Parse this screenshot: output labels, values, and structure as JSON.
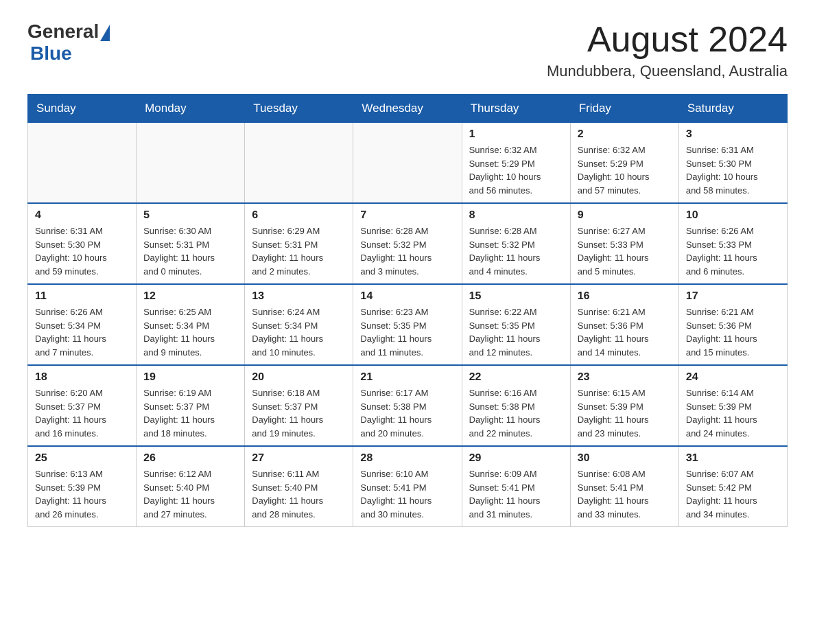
{
  "header": {
    "month_title": "August 2024",
    "location": "Mundubbera, Queensland, Australia",
    "logo_general": "General",
    "logo_blue": "Blue"
  },
  "weekdays": [
    "Sunday",
    "Monday",
    "Tuesday",
    "Wednesday",
    "Thursday",
    "Friday",
    "Saturday"
  ],
  "weeks": [
    [
      {
        "day": "",
        "info": ""
      },
      {
        "day": "",
        "info": ""
      },
      {
        "day": "",
        "info": ""
      },
      {
        "day": "",
        "info": ""
      },
      {
        "day": "1",
        "info": "Sunrise: 6:32 AM\nSunset: 5:29 PM\nDaylight: 10 hours\nand 56 minutes."
      },
      {
        "day": "2",
        "info": "Sunrise: 6:32 AM\nSunset: 5:29 PM\nDaylight: 10 hours\nand 57 minutes."
      },
      {
        "day": "3",
        "info": "Sunrise: 6:31 AM\nSunset: 5:30 PM\nDaylight: 10 hours\nand 58 minutes."
      }
    ],
    [
      {
        "day": "4",
        "info": "Sunrise: 6:31 AM\nSunset: 5:30 PM\nDaylight: 10 hours\nand 59 minutes."
      },
      {
        "day": "5",
        "info": "Sunrise: 6:30 AM\nSunset: 5:31 PM\nDaylight: 11 hours\nand 0 minutes."
      },
      {
        "day": "6",
        "info": "Sunrise: 6:29 AM\nSunset: 5:31 PM\nDaylight: 11 hours\nand 2 minutes."
      },
      {
        "day": "7",
        "info": "Sunrise: 6:28 AM\nSunset: 5:32 PM\nDaylight: 11 hours\nand 3 minutes."
      },
      {
        "day": "8",
        "info": "Sunrise: 6:28 AM\nSunset: 5:32 PM\nDaylight: 11 hours\nand 4 minutes."
      },
      {
        "day": "9",
        "info": "Sunrise: 6:27 AM\nSunset: 5:33 PM\nDaylight: 11 hours\nand 5 minutes."
      },
      {
        "day": "10",
        "info": "Sunrise: 6:26 AM\nSunset: 5:33 PM\nDaylight: 11 hours\nand 6 minutes."
      }
    ],
    [
      {
        "day": "11",
        "info": "Sunrise: 6:26 AM\nSunset: 5:34 PM\nDaylight: 11 hours\nand 7 minutes."
      },
      {
        "day": "12",
        "info": "Sunrise: 6:25 AM\nSunset: 5:34 PM\nDaylight: 11 hours\nand 9 minutes."
      },
      {
        "day": "13",
        "info": "Sunrise: 6:24 AM\nSunset: 5:34 PM\nDaylight: 11 hours\nand 10 minutes."
      },
      {
        "day": "14",
        "info": "Sunrise: 6:23 AM\nSunset: 5:35 PM\nDaylight: 11 hours\nand 11 minutes."
      },
      {
        "day": "15",
        "info": "Sunrise: 6:22 AM\nSunset: 5:35 PM\nDaylight: 11 hours\nand 12 minutes."
      },
      {
        "day": "16",
        "info": "Sunrise: 6:21 AM\nSunset: 5:36 PM\nDaylight: 11 hours\nand 14 minutes."
      },
      {
        "day": "17",
        "info": "Sunrise: 6:21 AM\nSunset: 5:36 PM\nDaylight: 11 hours\nand 15 minutes."
      }
    ],
    [
      {
        "day": "18",
        "info": "Sunrise: 6:20 AM\nSunset: 5:37 PM\nDaylight: 11 hours\nand 16 minutes."
      },
      {
        "day": "19",
        "info": "Sunrise: 6:19 AM\nSunset: 5:37 PM\nDaylight: 11 hours\nand 18 minutes."
      },
      {
        "day": "20",
        "info": "Sunrise: 6:18 AM\nSunset: 5:37 PM\nDaylight: 11 hours\nand 19 minutes."
      },
      {
        "day": "21",
        "info": "Sunrise: 6:17 AM\nSunset: 5:38 PM\nDaylight: 11 hours\nand 20 minutes."
      },
      {
        "day": "22",
        "info": "Sunrise: 6:16 AM\nSunset: 5:38 PM\nDaylight: 11 hours\nand 22 minutes."
      },
      {
        "day": "23",
        "info": "Sunrise: 6:15 AM\nSunset: 5:39 PM\nDaylight: 11 hours\nand 23 minutes."
      },
      {
        "day": "24",
        "info": "Sunrise: 6:14 AM\nSunset: 5:39 PM\nDaylight: 11 hours\nand 24 minutes."
      }
    ],
    [
      {
        "day": "25",
        "info": "Sunrise: 6:13 AM\nSunset: 5:39 PM\nDaylight: 11 hours\nand 26 minutes."
      },
      {
        "day": "26",
        "info": "Sunrise: 6:12 AM\nSunset: 5:40 PM\nDaylight: 11 hours\nand 27 minutes."
      },
      {
        "day": "27",
        "info": "Sunrise: 6:11 AM\nSunset: 5:40 PM\nDaylight: 11 hours\nand 28 minutes."
      },
      {
        "day": "28",
        "info": "Sunrise: 6:10 AM\nSunset: 5:41 PM\nDaylight: 11 hours\nand 30 minutes."
      },
      {
        "day": "29",
        "info": "Sunrise: 6:09 AM\nSunset: 5:41 PM\nDaylight: 11 hours\nand 31 minutes."
      },
      {
        "day": "30",
        "info": "Sunrise: 6:08 AM\nSunset: 5:41 PM\nDaylight: 11 hours\nand 33 minutes."
      },
      {
        "day": "31",
        "info": "Sunrise: 6:07 AM\nSunset: 5:42 PM\nDaylight: 11 hours\nand 34 minutes."
      }
    ]
  ]
}
